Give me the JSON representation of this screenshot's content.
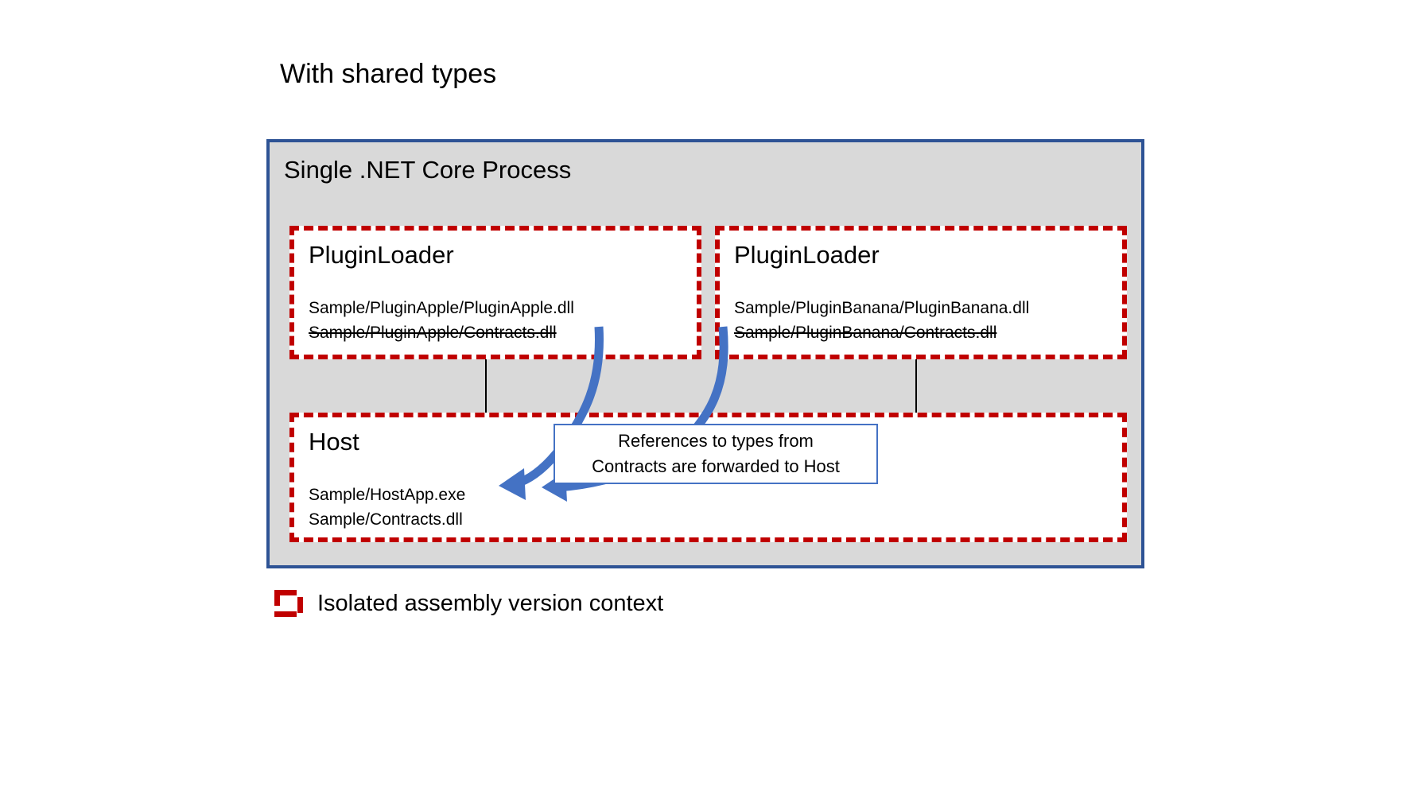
{
  "slide": {
    "title": "With shared types"
  },
  "process": {
    "title": "Single .NET Core Process",
    "border_color": "#2E5395",
    "fill_color": "#D9D9D9"
  },
  "isolation_color": "#C00000",
  "arrow_color": "#4472C4",
  "boxes": [
    {
      "id": "plugin-apple",
      "title": "PluginLoader",
      "lines": [
        {
          "text": "Sample/PluginApple/PluginApple.dll",
          "strikethrough": false
        },
        {
          "text": "Sample/PluginApple/Contracts.dll",
          "strikethrough": true
        }
      ]
    },
    {
      "id": "plugin-banana",
      "title": "PluginLoader",
      "lines": [
        {
          "text": "Sample/PluginBanana/PluginBanana.dll",
          "strikethrough": false
        },
        {
          "text": "Sample/PluginBanana/Contracts.dll",
          "strikethrough": true
        }
      ]
    },
    {
      "id": "host",
      "title": "Host",
      "lines": [
        {
          "text": "Sample/HostApp.exe",
          "strikethrough": false
        },
        {
          "text": "Sample/Contracts.dll",
          "strikethrough": false
        }
      ]
    }
  ],
  "callout": {
    "line1": "References to types from",
    "line2": "Contracts are forwarded to Host"
  },
  "legend": {
    "icon": "dashed-rectangle-icon",
    "label": "Isolated assembly version context"
  }
}
